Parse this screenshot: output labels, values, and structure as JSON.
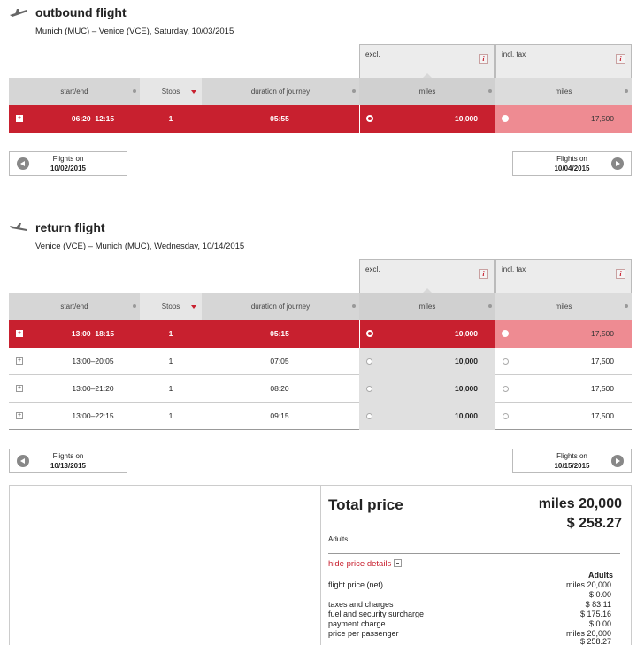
{
  "outbound": {
    "title": "outbound flight",
    "route": "Munich (MUC) – Venice (VCE),  Saturday, 10/03/2015",
    "tax_excl": "excl.",
    "tax_incl": "incl. tax",
    "columns": {
      "startend": "start/end",
      "stops": "Stops",
      "duration": "duration of journey",
      "miles1": "miles",
      "miles2": "miles"
    },
    "rows": [
      {
        "time": "06:20–12:15",
        "stops": "1",
        "duration": "05:55",
        "miles_excl": "10,000",
        "miles_incl": "17,500",
        "selected": true
      }
    ],
    "prev": {
      "line1": "Flights on",
      "date": "10/02/2015"
    },
    "next": {
      "line1": "Flights on",
      "date": "10/04/2015"
    }
  },
  "return": {
    "title": "return flight",
    "route": "Venice (VCE) – Munich (MUC),  Wednesday, 10/14/2015",
    "tax_excl": "excl.",
    "tax_incl": "incl. tax",
    "columns": {
      "startend": "start/end",
      "stops": "Stops",
      "duration": "duration of journey",
      "miles1": "miles",
      "miles2": "miles"
    },
    "rows": [
      {
        "time": "13:00–18:15",
        "stops": "1",
        "duration": "05:15",
        "miles_excl": "10,000",
        "miles_incl": "17,500",
        "selected": true
      },
      {
        "time": "13:00–20:05",
        "stops": "1",
        "duration": "07:05",
        "miles_excl": "10,000",
        "miles_incl": "17,500",
        "selected": false
      },
      {
        "time": "13:00–21:20",
        "stops": "1",
        "duration": "08:20",
        "miles_excl": "10,000",
        "miles_incl": "17,500",
        "selected": false
      },
      {
        "time": "13:00–22:15",
        "stops": "1",
        "duration": "09:15",
        "miles_excl": "10,000",
        "miles_incl": "17,500",
        "selected": false
      }
    ],
    "prev": {
      "line1": "Flights on",
      "date": "10/13/2015"
    },
    "next": {
      "line1": "Flights on",
      "date": "10/15/2015"
    }
  },
  "summary": {
    "total_label": "Total price",
    "total_miles": "miles 20,000",
    "total_usd": "$ 258.27",
    "adults_label": "Adults:",
    "hide_details": "hide price details",
    "breakdown_head": "Adults",
    "breakdown": [
      {
        "label": "flight price (net)",
        "value": "miles 20,000"
      },
      {
        "label": "",
        "value": "$ 0.00"
      },
      {
        "label": "taxes and charges",
        "value": "$ 83.11"
      },
      {
        "label": "fuel and security surcharge",
        "value": "$ 175.16"
      },
      {
        "label": "payment charge",
        "value": "$ 0.00"
      },
      {
        "label": "price per passenger",
        "value": "miles 20,000"
      },
      {
        "label": "",
        "value": "$ 258.27"
      }
    ]
  },
  "icons": {
    "outbound": "plane-takeoff-icon",
    "return": "plane-landing-icon",
    "info": "info-icon"
  },
  "colors": {
    "accent": "#c8202f",
    "accent_light": "#ee8b92",
    "header_gray": "#d6d6d6"
  }
}
